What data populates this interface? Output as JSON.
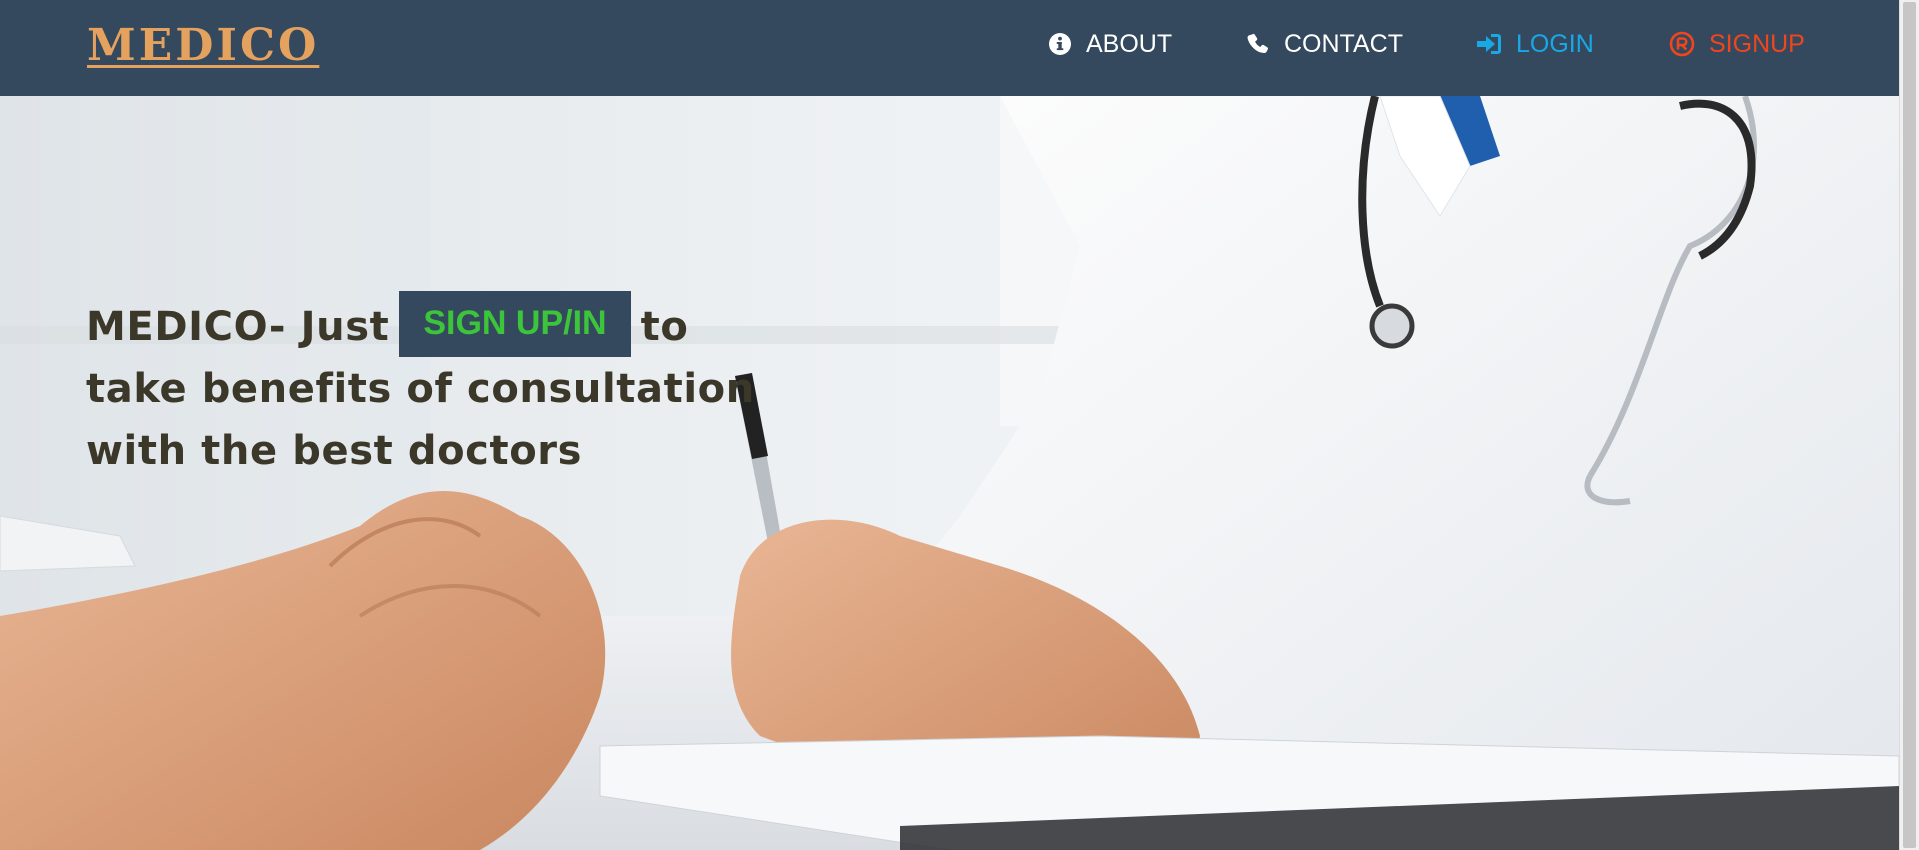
{
  "navbar": {
    "brand": "MEDICO",
    "items": [
      {
        "label": "ABOUT",
        "icon": "info-circle-icon",
        "color": "#ffffff"
      },
      {
        "label": "CONTACT",
        "icon": "phone-icon",
        "color": "#ffffff"
      },
      {
        "label": "LOGIN",
        "icon": "sign-in-icon",
        "color": "#18a8e6"
      },
      {
        "label": "SIGNUP",
        "icon": "registered-icon",
        "color": "#f0451d"
      }
    ],
    "background": "#34495e",
    "brand_color": "#e4a25e"
  },
  "hero": {
    "text_before": "MEDICO- Just",
    "cta_label": "SIGN UP/IN",
    "text_after": "to",
    "line2": "take benefits of consultation",
    "line3": "with the best doctors",
    "cta_text_color": "#3cc43a",
    "cta_background": "#34495e",
    "background_image": "doctor-writing-with-patient-photo"
  }
}
